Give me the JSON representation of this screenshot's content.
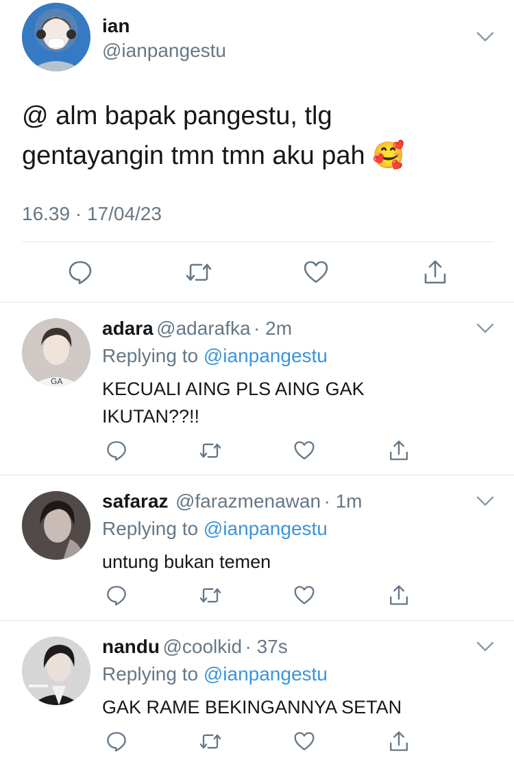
{
  "main_tweet": {
    "name": "ian",
    "handle": "@ianpangestu",
    "text_line1": "@ alm bapak pangestu, tlg",
    "text_line2": "gentayangin tmn tmn aku pah",
    "emoji": "🥰",
    "timestamp": "16.39 · 17/04/23"
  },
  "replies": [
    {
      "name": "adara",
      "handle": "@adarafka",
      "time": "· 2m",
      "replying_prefix": "Replying to",
      "replying_to": "@ianpangestu",
      "text_lines": [
        "KECUALI AING PLS AING GAK",
        "IKUTAN??!!"
      ]
    },
    {
      "name": "safaraz",
      "handle": "@farazmenawan",
      "time": "· 1m",
      "replying_prefix": "Replying to",
      "replying_to": "@ianpangestu",
      "text_lines": [
        "untung bukan temen"
      ]
    },
    {
      "name": "nandu",
      "handle": "@coolkid",
      "time": "· 37s",
      "replying_prefix": "Replying to",
      "replying_to": "@ianpangestu",
      "text_lines": [
        "GAK RAME BEKINGANNYA SETAN"
      ]
    }
  ],
  "icons": {
    "reply": "reply-icon",
    "retweet": "retweet-icon",
    "like": "like-icon",
    "share": "share-icon",
    "more": "chevron-down-icon"
  },
  "colors": {
    "text": "#14171a",
    "secondary": "#657786",
    "link": "#3b94d9",
    "divider": "#e1e8ed"
  }
}
